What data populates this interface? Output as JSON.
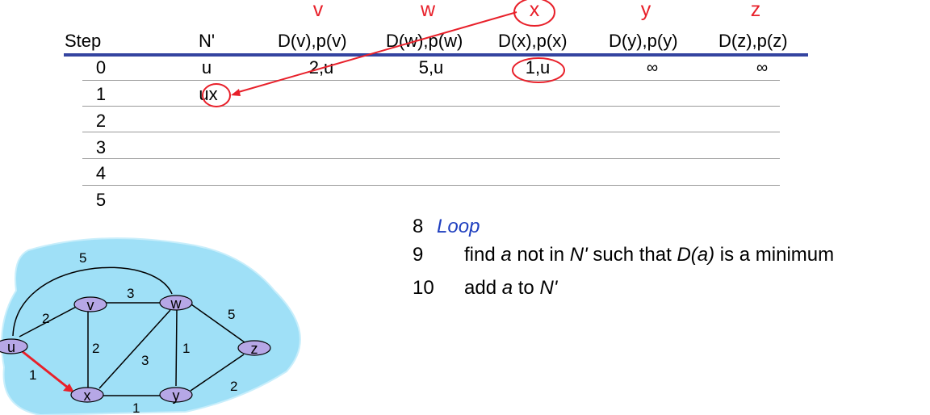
{
  "destinations": [
    "v",
    "w",
    "x",
    "y",
    "z"
  ],
  "table": {
    "step_header": "Step",
    "nprime_header": "N'",
    "col_headers": [
      "D(v),p(v)",
      "D(w),p(w)",
      "D(x),p(x)",
      "D(y),p(y)",
      "D(z),p(z)"
    ],
    "rows": [
      {
        "step": "0",
        "nprime": "u",
        "cells": [
          "2,u",
          "5,u",
          "1,u",
          "∞",
          "∞"
        ]
      },
      {
        "step": "1",
        "nprime": "ux",
        "cells": [
          "",
          "",
          "",
          "",
          ""
        ]
      },
      {
        "step": "2",
        "nprime": "",
        "cells": [
          "",
          "",
          "",
          "",
          ""
        ]
      },
      {
        "step": "3",
        "nprime": "",
        "cells": [
          "",
          "",
          "",
          "",
          ""
        ]
      },
      {
        "step": "4",
        "nprime": "",
        "cells": [
          "",
          "",
          "",
          "",
          ""
        ]
      },
      {
        "step": "5",
        "nprime": "",
        "cells": [
          "",
          "",
          "",
          "",
          ""
        ]
      }
    ]
  },
  "algorithm": [
    {
      "num": "8",
      "text": "Loop"
    },
    {
      "num": "9",
      "pre": "find ",
      "a": "a",
      "mid": " not in ",
      "n": "N'",
      "post": " such that ",
      "da": "D(a)",
      "end": " is a minimum"
    },
    {
      "num": "10",
      "pre": "add ",
      "a": "a",
      "mid": " to ",
      "n": "N'"
    }
  ],
  "graph": {
    "nodes": [
      "u",
      "v",
      "w",
      "x",
      "y",
      "z"
    ],
    "edges": [
      {
        "from": "u",
        "to": "v",
        "cost": "2"
      },
      {
        "from": "u",
        "to": "w",
        "cost": "5"
      },
      {
        "from": "u",
        "to": "x",
        "cost": "1"
      },
      {
        "from": "v",
        "to": "w",
        "cost": "3"
      },
      {
        "from": "v",
        "to": "x",
        "cost": "2"
      },
      {
        "from": "w",
        "to": "x",
        "cost": "3"
      },
      {
        "from": "w",
        "to": "y",
        "cost": "1"
      },
      {
        "from": "w",
        "to": "z",
        "cost": "5"
      },
      {
        "from": "x",
        "to": "y",
        "cost": "1"
      },
      {
        "from": "y",
        "to": "z",
        "cost": "2"
      }
    ]
  },
  "colors": {
    "highlight": "#e8202a",
    "header_rule": "#3444a0",
    "cloud": "#9fe0f7",
    "keyword": "#1f3fbf"
  }
}
